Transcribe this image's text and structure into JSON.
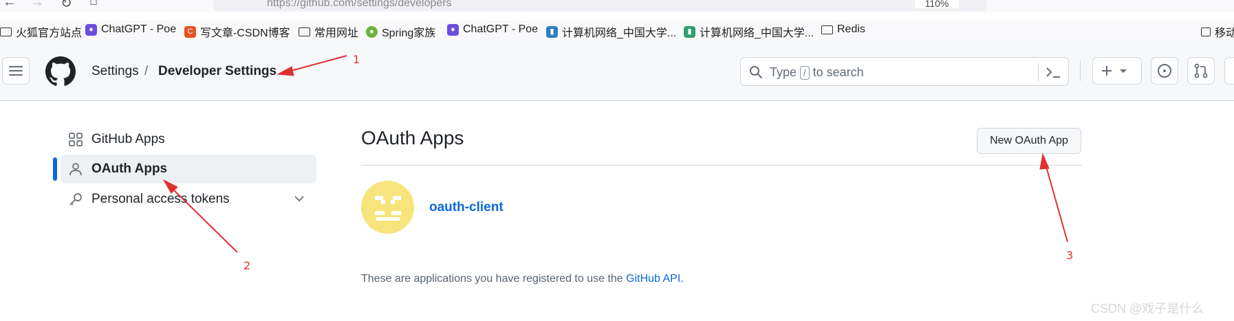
{
  "browser": {
    "url": "https://github.com/settings/developers",
    "zoom": "110%",
    "bookmarks": [
      {
        "label": "火狐官方站点",
        "icon": "folder-icon"
      },
      {
        "label": "ChatGPT - Poe",
        "icon": "poe-icon"
      },
      {
        "label": "写文章-CSDN博客",
        "icon": "csdn-icon"
      },
      {
        "label": "常用网址",
        "icon": "folder-icon"
      },
      {
        "label": "Spring家族",
        "icon": "spring-icon"
      },
      {
        "label": "ChatGPT - Poe",
        "icon": "poe-icon"
      },
      {
        "label": "计算机网络_中国大学...",
        "icon": "mooc-icon"
      },
      {
        "label": "计算机网络_中国大学...",
        "icon": "mooc-icon"
      },
      {
        "label": "Redis",
        "icon": "folder-icon"
      },
      {
        "label": "移动",
        "icon": "mobile-icon"
      }
    ]
  },
  "header": {
    "breadcrumb_parent": "Settings",
    "breadcrumb_sep": "/",
    "breadcrumb_current": "Developer Settings",
    "search_type": "Type",
    "search_key": "/",
    "search_suffix": "to search"
  },
  "sidebar": {
    "items": [
      {
        "label": "GitHub Apps",
        "icon": "apps-icon"
      },
      {
        "label": "OAuth Apps",
        "icon": "person-icon"
      },
      {
        "label": "Personal access tokens",
        "icon": "key-icon"
      }
    ]
  },
  "main": {
    "title": "OAuth Apps",
    "new_button": "New OAuth App",
    "apps": [
      {
        "name": "oauth-client"
      }
    ],
    "footer_prefix": "These are applications you have registered to use the ",
    "footer_link": "GitHub API",
    "footer_suffix": "."
  },
  "annotations": [
    "1",
    "2",
    "3"
  ],
  "watermark": "CSDN @戏子是什么",
  "colors": {
    "accent": "#0969da",
    "annotation": "#e03030",
    "avatar": "#f8e47c"
  }
}
